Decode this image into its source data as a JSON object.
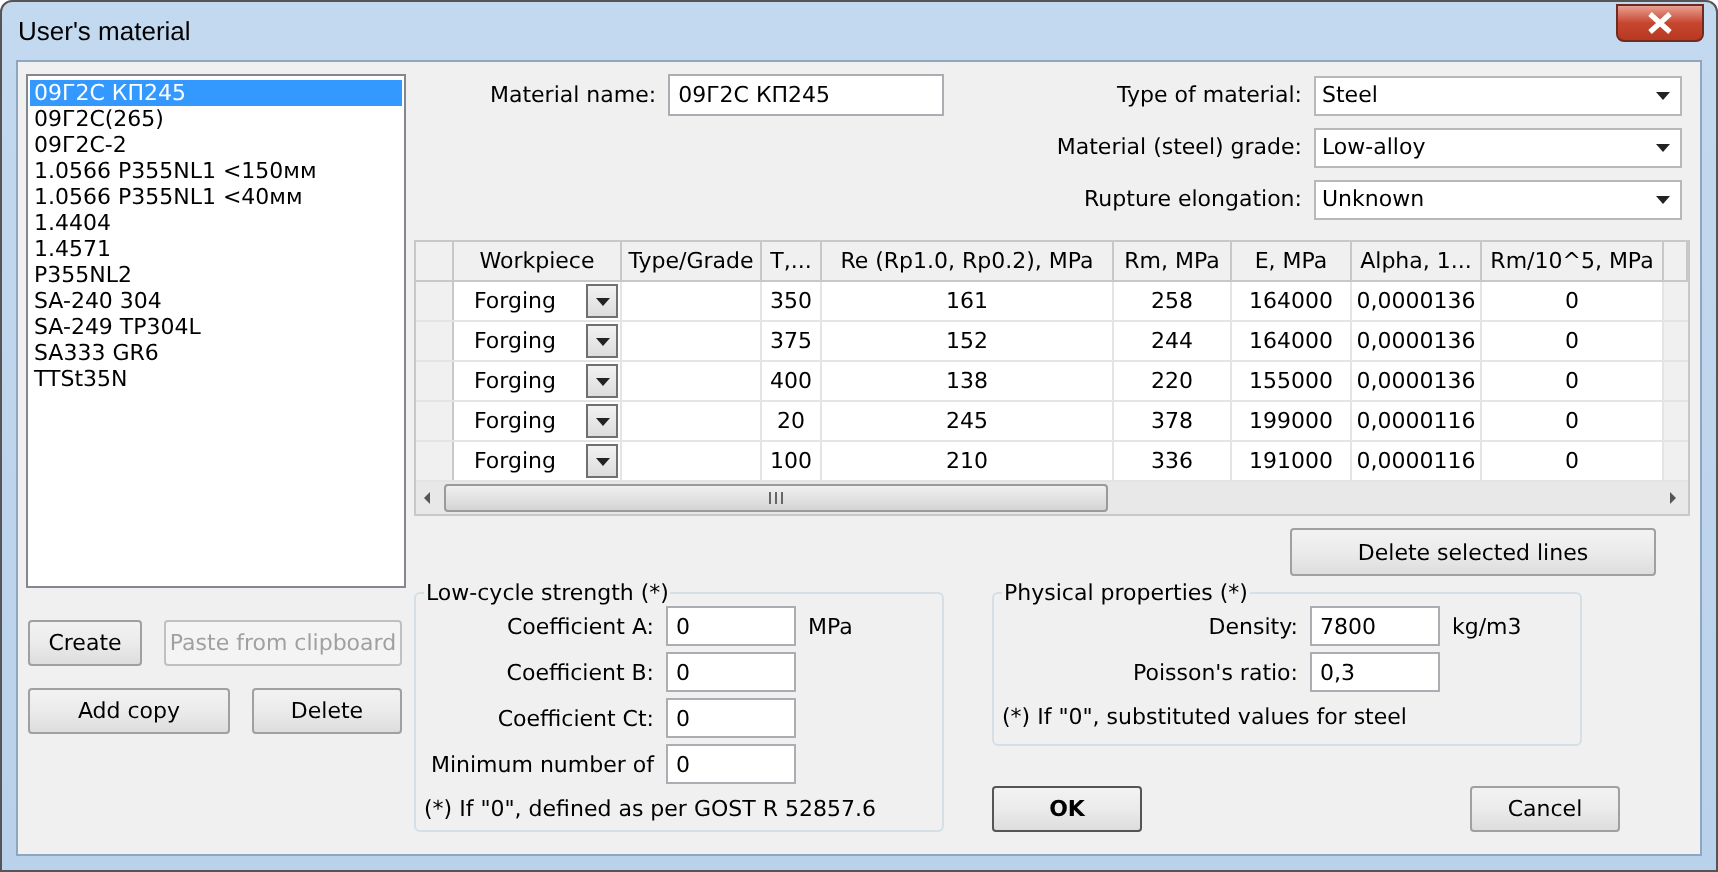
{
  "window": {
    "title": "User's material"
  },
  "materials": [
    {
      "label": "09Г2С КП245",
      "selected": true
    },
    {
      "label": "09Г2С(265)",
      "selected": false
    },
    {
      "label": "09Г2С-2",
      "selected": false
    },
    {
      "label": "1.0566 P355NL1 <150мм",
      "selected": false
    },
    {
      "label": "1.0566 P355NL1 <40мм",
      "selected": false
    },
    {
      "label": "1.4404",
      "selected": false
    },
    {
      "label": "1.4571",
      "selected": false
    },
    {
      "label": "P355NL2",
      "selected": false
    },
    {
      "label": "SA-240 304",
      "selected": false
    },
    {
      "label": "SA-249 TP304L",
      "selected": false
    },
    {
      "label": "SA333 GR6",
      "selected": false
    },
    {
      "label": "TTSt35N",
      "selected": false
    }
  ],
  "list_buttons": [
    {
      "label": "Create",
      "disabled": false
    },
    {
      "label": "Paste from clipboard",
      "disabled": true
    },
    {
      "label": "Add copy",
      "disabled": false
    },
    {
      "label": "Delete",
      "disabled": false
    }
  ],
  "material_name": {
    "label": "Material name:",
    "value": "09Г2С КП245"
  },
  "selects": [
    {
      "label": "Type of material:",
      "value": "Steel"
    },
    {
      "label": "Material (steel) grade:",
      "value": "Low-alloy"
    },
    {
      "label": "Rupture elongation:",
      "value": "Unknown"
    }
  ],
  "table": {
    "columns": [
      "Workpiece",
      "Type/Grade",
      "T,...",
      "Re (Rp1.0, Rp0.2), MPa",
      "Rm, MPa",
      "E, MPa",
      "Alpha, 1...",
      "Rm/10^5, MPa"
    ],
    "rows": [
      [
        "Forging",
        "",
        "350",
        "161",
        "258",
        "164000",
        "0,0000136",
        "0"
      ],
      [
        "Forging",
        "",
        "375",
        "152",
        "244",
        "164000",
        "0,0000136",
        "0"
      ],
      [
        "Forging",
        "",
        "400",
        "138",
        "220",
        "155000",
        "0,0000136",
        "0"
      ],
      [
        "Forging",
        "",
        "20",
        "245",
        "378",
        "199000",
        "0,0000116",
        "0"
      ],
      [
        "Forging",
        "",
        "100",
        "210",
        "336",
        "191000",
        "0,0000116",
        "0"
      ]
    ]
  },
  "delete_lines_button": "Delete selected lines",
  "low_cycle": {
    "title": "Low-cycle strength (*)",
    "fields": [
      {
        "label": "Coefficient A:",
        "value": "0",
        "unit": "MPa"
      },
      {
        "label": "Coefficient B:",
        "value": "0"
      },
      {
        "label": "Coefficient Ct:",
        "value": "0"
      },
      {
        "label": "Minimum number of",
        "value": "0"
      }
    ],
    "note": "(*) If \"0\", defined as per GOST R 52857.6"
  },
  "physical": {
    "title": "Physical properties (*)",
    "fields": [
      {
        "label": "Density:",
        "value": "7800",
        "unit": "kg/m3"
      },
      {
        "label": "Poisson's ratio:",
        "value": "0,3"
      }
    ],
    "note": "(*) If \"0\", substituted values for steel"
  },
  "buttons": [
    {
      "label": "OK",
      "default": true
    },
    {
      "label": "Cancel",
      "default": false
    }
  ]
}
